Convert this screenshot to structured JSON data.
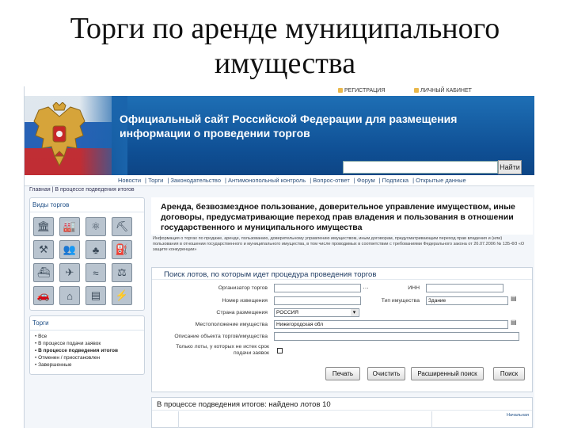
{
  "slide_title": "Торги по аренде муниципального имущества",
  "topbar": {
    "register": "РЕГИСТРАЦИЯ",
    "cabinet": "ЛИЧНЫЙ КАБИНЕТ"
  },
  "banner": {
    "site_title": "Официальный сайт Российской Федерации для размещения информации о проведении торгов",
    "search_button": "Найти",
    "search_value": ""
  },
  "nav": {
    "items": [
      "Новости",
      "Торги",
      "Законодательство",
      "Антимонопольный контроль",
      "Вопрос-ответ",
      "Форум",
      "Подписка",
      "Открытые данные"
    ]
  },
  "breadcrumbs": "Главная | В процессе подведения итогов",
  "sidebar": {
    "types_title": "Виды торгов",
    "icons": [
      "building-icon",
      "factory-icon",
      "atom-icon",
      "derrick-icon",
      "crane-icon",
      "people-icon",
      "tree-icon",
      "oil-pump-icon",
      "ship-icon",
      "fish-icon",
      "water-icon",
      "scales-icon",
      "car-icon",
      "house-icon",
      "document-icon",
      "tower-icon"
    ],
    "torgi_title": "Торги",
    "torgi_items": [
      "Все",
      "В процессе подачи заявок",
      "В процессе подведения итогов",
      "Отменен / приостановлен",
      "Завершенные"
    ]
  },
  "main": {
    "heading": "Аренда, безвозмездное пользование, доверительное управление имуществом, иные договоры, предусматривающие переход прав владения и пользования в отношении государственного и муниципального имущества",
    "description": "Информация о торгах по продаже, аренде, пользованию, доверительному управлению имуществом, иным договорам, предусматривающим переход прав владения и (или) пользования в отношении государственного и муниципального имущества, в том числе проводимых в соответствии с требованиями Федерального закона от 26.07.2006 № 135-ФЗ «О защите конкуренции»",
    "form": {
      "title": "Поиск лотов, по которым идет процедура проведения торгов",
      "labels": {
        "organizer": "Организатор торгов",
        "notice_number": "Номер извещения",
        "country": "Страна размещения",
        "location": "Местоположение имущества",
        "description": "Описание объекта торгов/имущества",
        "only_lots": "Только лоты, у которых не истек срок подачи заявок",
        "inn": "ИНН",
        "property_type": "Тип имущества"
      },
      "values": {
        "organizer": "",
        "notice_number": "",
        "country": "РОССИЯ",
        "location": "Нижегородская обл",
        "description": "",
        "inn": "",
        "property_type": "Здание"
      },
      "buttons": {
        "print": "Печать",
        "clear": "Очистить",
        "advanced": "Расширенный поиск",
        "search": "Поиск"
      }
    },
    "results_title": "В процессе подведения итогов: найдено лотов 10",
    "results_col_header": "Начальная"
  }
}
